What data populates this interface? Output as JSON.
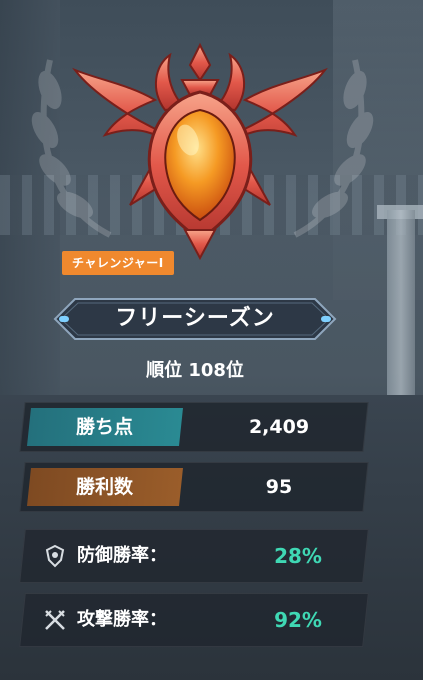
{
  "rank_badge": {
    "tier_label": "チャレンジャーⅠ"
  },
  "season": {
    "name": "フリーシーズン"
  },
  "ranking": {
    "text": "順位 108位"
  },
  "stats": [
    {
      "label": "勝ち点",
      "value": "2,409",
      "accent": "#2a8a93"
    },
    {
      "label": "勝利数",
      "value": "95",
      "accent": "#9a5d2a"
    }
  ],
  "rates": [
    {
      "label": "防御勝率：",
      "value": "28%",
      "icon": "defense-icon"
    },
    {
      "label": "攻撃勝率：",
      "value": "92%",
      "icon": "attack-icon"
    }
  ],
  "colors": {
    "rate_value": "#3fd8b4",
    "tag_bg": "#f0892e",
    "gem": "#f07a1e"
  }
}
